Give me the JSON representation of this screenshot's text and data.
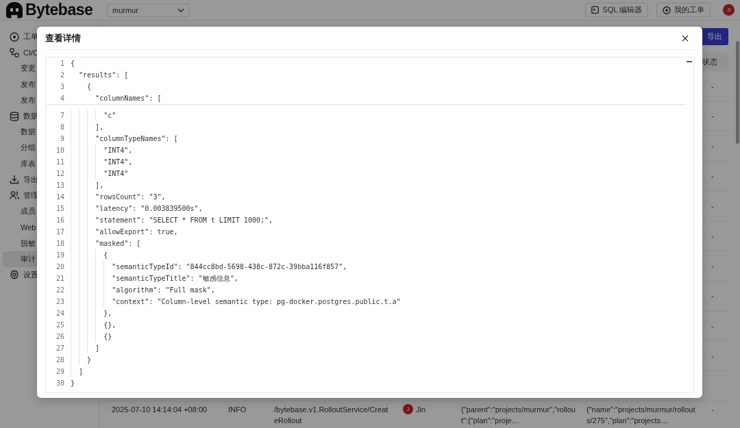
{
  "topbar": {
    "logo": "Bytebase",
    "project_select": "murmur",
    "buttons": [
      {
        "label": "SQL 编辑器",
        "kind": "terminal"
      },
      {
        "label": "我的工单",
        "kind": "issue"
      }
    ],
    "avatar": "JI"
  },
  "sidebar": {
    "items": [
      {
        "label": "工单",
        "kind": "section",
        "selected": false
      },
      {
        "label": "CI/C",
        "kind": "section",
        "selected": false
      },
      {
        "label": "变更",
        "kind": "sub",
        "selected": false
      },
      {
        "label": "发布",
        "kind": "sub",
        "selected": false
      },
      {
        "label": "发布",
        "kind": "sub",
        "selected": false
      },
      {
        "label": "数据",
        "kind": "section",
        "selected": false
      },
      {
        "label": "数据",
        "kind": "sub",
        "selected": false
      },
      {
        "label": "分组",
        "kind": "sub",
        "selected": false
      },
      {
        "label": "库表",
        "kind": "sub",
        "selected": false
      },
      {
        "label": "导出",
        "kind": "section",
        "selected": false
      },
      {
        "label": "管理",
        "kind": "section",
        "selected": false
      },
      {
        "label": "成员",
        "kind": "sub",
        "selected": false
      },
      {
        "label": "Web",
        "kind": "sub",
        "selected": false
      },
      {
        "label": "脱敏",
        "kind": "sub",
        "selected": false
      },
      {
        "label": "审计",
        "kind": "sub",
        "selected": true
      },
      {
        "label": "设置",
        "kind": "section",
        "selected": false
      }
    ]
  },
  "main": {
    "export_button": "导出",
    "table": {
      "columns": [
        "状态"
      ],
      "rows": [
        {
          "status": "-"
        },
        {
          "status": "-"
        },
        {
          "status": "-"
        },
        {
          "status": "-"
        },
        {
          "status": "-"
        },
        {
          "status": "-"
        },
        {
          "status": "-"
        },
        {
          "status": "-"
        },
        {
          "status": "-"
        },
        {
          "status": "-"
        }
      ],
      "last_row": {
        "time": "2025-07-10 14:14:04 +08:00",
        "level": "INFO",
        "method": "/bytebase.v1.RolloutService/CreateRollout",
        "user_avatar": "J",
        "user": "Jin",
        "request": "{\"parent\":\"projects/murmur\",\"rollout\":{\"plan\":\"proje…",
        "response": "{\"name\":\"projects/murmur/rollouts/275\",\"plan\":\"projects…",
        "status": "-"
      }
    }
  },
  "dialog": {
    "title": "查看详情",
    "sticky_lines": [
      {
        "number": "1",
        "text": "{"
      },
      {
        "number": "2",
        "text": "  \"results\": ["
      },
      {
        "number": "3",
        "text": "    {"
      },
      {
        "number": "4",
        "text": "      \"columnNames\": ["
      }
    ],
    "lines": [
      {
        "number": "7",
        "text": "        \"c\""
      },
      {
        "number": "8",
        "text": "      ],"
      },
      {
        "number": "9",
        "text": "      \"columnTypeNames\": ["
      },
      {
        "number": "10",
        "text": "        \"INT4\","
      },
      {
        "number": "11",
        "text": "        \"INT4\","
      },
      {
        "number": "12",
        "text": "        \"INT4\""
      },
      {
        "number": "13",
        "text": "      ],"
      },
      {
        "number": "14",
        "text": "      \"rowsCount\": \"3\","
      },
      {
        "number": "15",
        "text": "      \"latency\": \"0.003839500s\","
      },
      {
        "number": "16",
        "text": "      \"statement\": \"SELECT * FROM t LIMIT 1000;\","
      },
      {
        "number": "17",
        "text": "      \"allowExport\": true,"
      },
      {
        "number": "18",
        "text": "      \"masked\": ["
      },
      {
        "number": "19",
        "text": "        {"
      },
      {
        "number": "20",
        "text": "          \"semanticTypeId\": \"844cc8bd-5698-438c-872c-39bba116f857\","
      },
      {
        "number": "21",
        "text": "          \"semanticTypeTitle\": \"敏感信息\","
      },
      {
        "number": "22",
        "text": "          \"algorithm\": \"Full mask\","
      },
      {
        "number": "23",
        "text": "          \"context\": \"Column-level semantic type: pg-docker.postgres.public.t.a\""
      },
      {
        "number": "24",
        "text": "        },"
      },
      {
        "number": "25",
        "text": "        {},"
      },
      {
        "number": "26",
        "text": "        {}"
      },
      {
        "number": "27",
        "text": "      ]"
      },
      {
        "number": "28",
        "text": "    }"
      },
      {
        "number": "29",
        "text": "  ]"
      },
      {
        "number": "30",
        "text": "}"
      }
    ]
  }
}
